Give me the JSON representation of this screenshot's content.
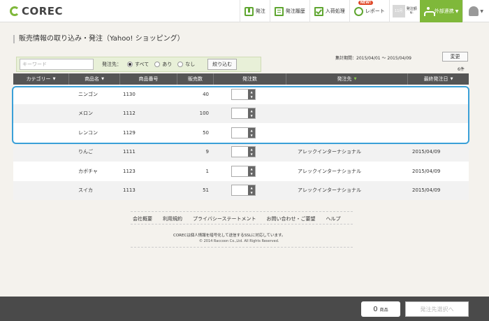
{
  "header": {
    "logo_text": "COREC",
    "nav": [
      {
        "label": "発注",
        "icon": "order-icon"
      },
      {
        "label": "発注履歴",
        "icon": "history-icon"
      },
      {
        "label": "入荷処理",
        "icon": "receive-check-icon"
      },
      {
        "label": "レポート",
        "icon": "report-icon",
        "badge": "NEW!"
      }
    ],
    "stock_tile": "11月",
    "stock_label_line1": "発注額",
    "stock_label_line2": "¥-",
    "external_label": "外部連携"
  },
  "page_title": "販売情報の取り込み・発注（Yahoo! ショッピング）",
  "filter": {
    "keyword_placeholder": "キーワード",
    "destination_label": "発注先：",
    "options": [
      "すべて",
      "あり",
      "なし"
    ],
    "selected": "すべて",
    "narrow_button": "絞り込む"
  },
  "period_text": "集計期間：2015/04/01 ～ 2015/04/09",
  "change_button": "変更",
  "count_text": "6件",
  "table": {
    "headers": [
      "カテゴリー",
      "商品名",
      "商品番号",
      "販売数",
      "発注数",
      "発注先",
      "最終発注日"
    ],
    "rows": [
      {
        "category": "",
        "name": "ニンゴン",
        "number": "1130",
        "sold": "40",
        "dest": "",
        "last": ""
      },
      {
        "category": "",
        "name": "メロン",
        "number": "1112",
        "sold": "100",
        "dest": "",
        "last": ""
      },
      {
        "category": "",
        "name": "レンコン",
        "number": "1129",
        "sold": "50",
        "dest": "",
        "last": ""
      },
      {
        "category": "",
        "name": "りんご",
        "number": "1111",
        "sold": "9",
        "dest": "アレックインターナショナル",
        "last": "2015/04/09"
      },
      {
        "category": "",
        "name": "カボチャ",
        "number": "1123",
        "sold": "1",
        "dest": "アレックインターナショナル",
        "last": "2015/04/09"
      },
      {
        "category": "",
        "name": "スイカ",
        "number": "1113",
        "sold": "51",
        "dest": "アレックインターナショナル",
        "last": "2015/04/09"
      }
    ]
  },
  "footer": {
    "links": [
      "会社概要",
      "利用規約",
      "プライバシーステートメント",
      "お問い合わせ・ご要望",
      "ヘルプ"
    ],
    "ssl_text": "CORECは個人情報を暗号化して送信するSSLに対応しています。",
    "copyright": "© 2014 Raccoon Co.,Ltd. All Rights Reserved."
  },
  "bottom": {
    "cart_count": "0",
    "cart_unit": "商品",
    "go_button": "発注先選択へ"
  },
  "colors": {
    "accent": "#7fb83a",
    "highlight": "#3aa0d8",
    "header_dark": "#555555"
  }
}
